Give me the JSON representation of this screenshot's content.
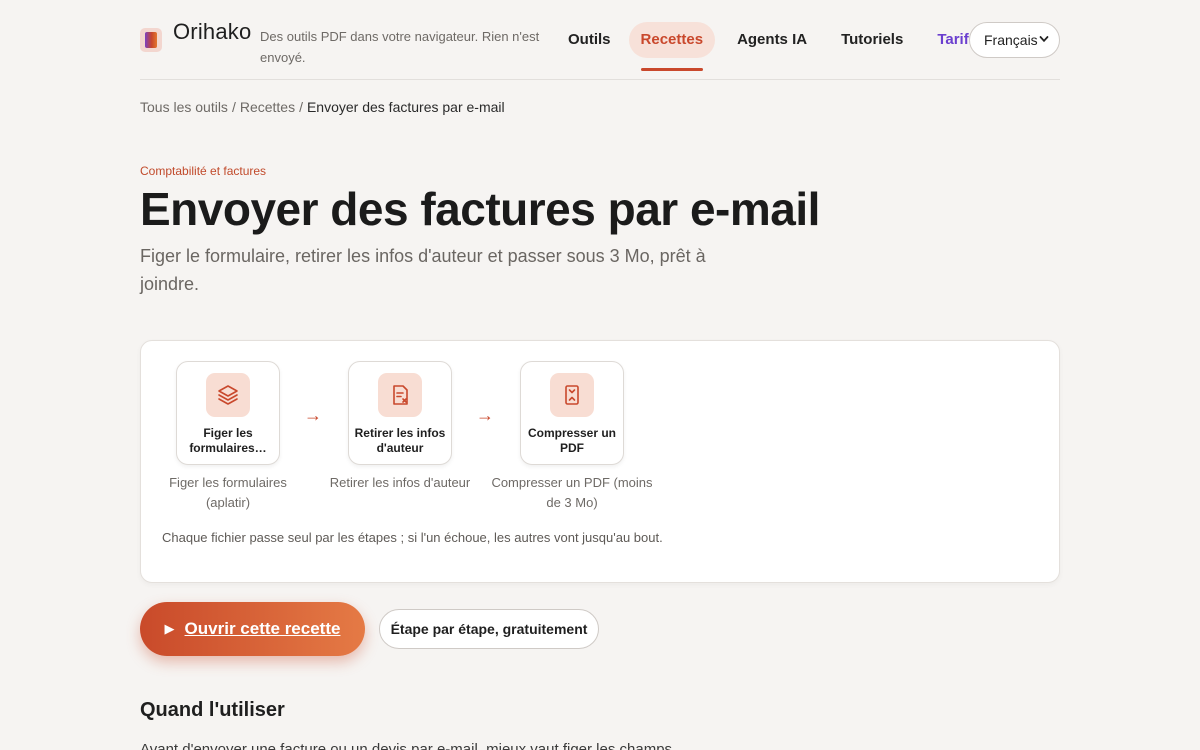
{
  "header": {
    "brand": "Orihako",
    "tagline": "Des outils PDF dans votre navigateur. Rien n'est envoyé.",
    "nav": [
      {
        "label": "Outils"
      },
      {
        "label": "Recettes"
      },
      {
        "label": "Agents IA"
      },
      {
        "label": "Tutoriels"
      },
      {
        "label": "Tarifs"
      }
    ],
    "language": "Français"
  },
  "breadcrumb": {
    "items": [
      "Tous les outils",
      "Recettes"
    ],
    "current": "Envoyer des factures par e-mail",
    "separator": "/"
  },
  "hero": {
    "eyebrow": "Comptabilité et factures",
    "title": "Envoyer des factures par e-mail",
    "subtitle": "Figer le formulaire, retirer les infos d'auteur et passer sous 3 Mo, prêt à joindre."
  },
  "pipeline": {
    "steps": [
      {
        "name": "Figer les formulaires…",
        "caption": "Figer les formulaires (aplatir)",
        "icon": "layers-icon"
      },
      {
        "name": "Retirer les infos d'auteur",
        "caption": "Retirer les infos d'auteur",
        "icon": "document-remove-icon"
      },
      {
        "name": "Compresser un PDF",
        "caption": "Compresser un PDF (moins de 3 Mo)",
        "icon": "compress-icon"
      }
    ],
    "arrow": "→",
    "note": "Chaque fichier passe seul par les étapes ; si l'un échoue, les autres vont jusqu'au bout."
  },
  "actions": {
    "primary": "Ouvrir cette recette",
    "primary_icon": "▶",
    "secondary": "Étape par étape, gratuitement"
  },
  "section": {
    "title": "Quand l'utiliser",
    "text": "Avant d'envoyer une facture ou un devis par e-mail, mieux vaut figer les champs"
  },
  "colors": {
    "accent": "#c9482c",
    "accent_light": "#f8ddd3",
    "pricing": "#6b3fcf",
    "background": "#f6f4f2"
  }
}
